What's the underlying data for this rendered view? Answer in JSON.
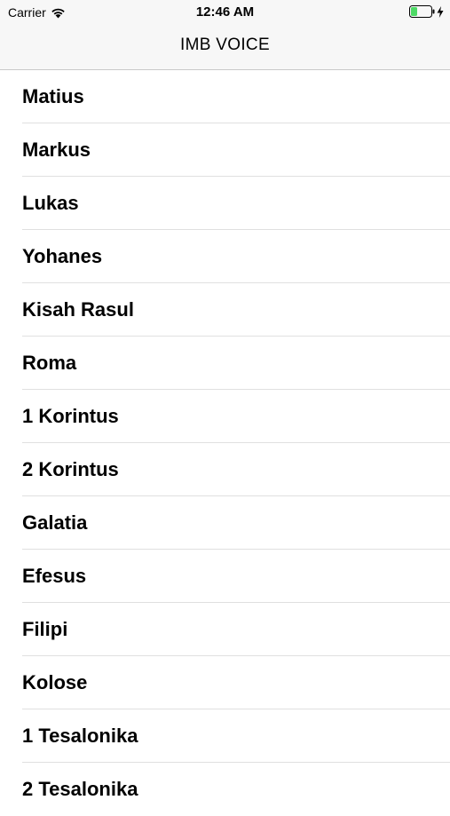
{
  "status_bar": {
    "carrier": "Carrier",
    "time": "12:46 AM",
    "wifi_icon": "wifi-icon",
    "battery_icon": "battery-icon",
    "battery_color": "#4cd964"
  },
  "nav": {
    "title": "IMB VOICE"
  },
  "books": [
    {
      "label": "Matius"
    },
    {
      "label": "Markus"
    },
    {
      "label": "Lukas"
    },
    {
      "label": "Yohanes"
    },
    {
      "label": "Kisah Rasul"
    },
    {
      "label": "Roma"
    },
    {
      "label": "1 Korintus"
    },
    {
      "label": "2 Korintus"
    },
    {
      "label": "Galatia"
    },
    {
      "label": "Efesus"
    },
    {
      "label": "Filipi"
    },
    {
      "label": "Kolose"
    },
    {
      "label": "1 Tesalonika"
    },
    {
      "label": "2 Tesalonika"
    }
  ]
}
